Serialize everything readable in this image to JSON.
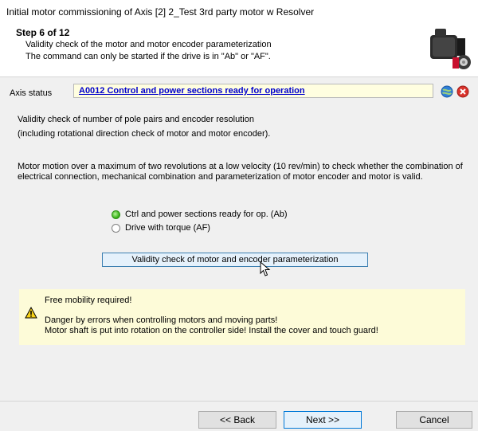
{
  "window": {
    "title": "Initial motor commissioning of Axis [2] 2_Test 3rd party motor w Resolver"
  },
  "header": {
    "step": "Step 6 of 12",
    "line1": "Validity check of the motor and motor encoder parameterization",
    "line2": "The command can only be started if the drive is in \"Ab\" or \"AF\"."
  },
  "axis_status": {
    "label": "Axis status",
    "value": "A0012 Control and power sections ready for operation"
  },
  "body": {
    "p1_line1": "Validity check of number of pole pairs and encoder resolution",
    "p1_line2": "(including rotational direction check of motor and motor encoder).",
    "p2_line1": "Motor motion over a maximum of two revolutions at a low velocity (10 rev/min) to check whether the combination of",
    "p2_line2": "electrical connection, mechanical combination and parameterization of motor encoder and motor is valid."
  },
  "status_options": [
    {
      "label": "Ctrl and power sections ready for op. (Ab)",
      "active": true
    },
    {
      "label": "Drive with torque (AF)",
      "active": false
    }
  ],
  "check_button": "Validity check of motor and encoder parameterization",
  "warning": {
    "line1": "Free mobility required!",
    "line2": "Danger by errors when controlling motors and moving parts!",
    "line3": "Motor shaft is put into rotation on the controller side! Install the cover and touch guard!"
  },
  "footer": {
    "back": "<< Back",
    "next": "Next >>",
    "cancel": "Cancel"
  },
  "colors": {
    "accent": "#0078d7",
    "link": "#0000cc",
    "status_field_bg": "#fffee0",
    "warning_bg": "#fdfbd8",
    "active_led": "#3fb81e"
  },
  "icons": [
    "motor-image-icon",
    "globe-icon",
    "close-icon",
    "warning-icon",
    "mouse-cursor-icon"
  ]
}
